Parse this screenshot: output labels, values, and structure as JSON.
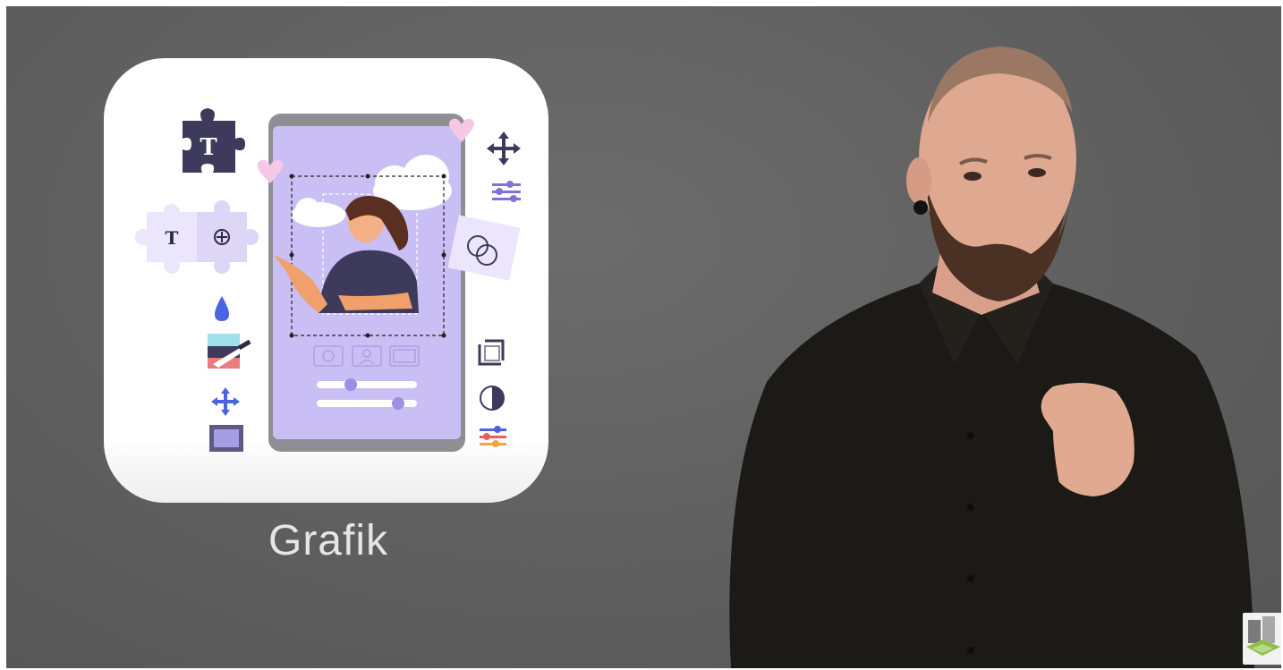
{
  "slide": {
    "caption": "Grafik"
  },
  "colors": {
    "background": "#5f5f5f",
    "card": "#ffffff",
    "accent_purple": "#c9bff5",
    "dark_navy": "#3e3a5c"
  },
  "icons": [
    "puzzle-text-icon",
    "heart-icon",
    "move-icon",
    "sliders-icon",
    "text-and-add-puzzle-icon",
    "rings-puzzle-icon",
    "droplet-icon",
    "paint-knife-icon",
    "crop-icon",
    "contrast-icon",
    "frame-icon",
    "camera-icon",
    "portrait-icon"
  ],
  "presenter": {
    "description_hidden": true
  }
}
